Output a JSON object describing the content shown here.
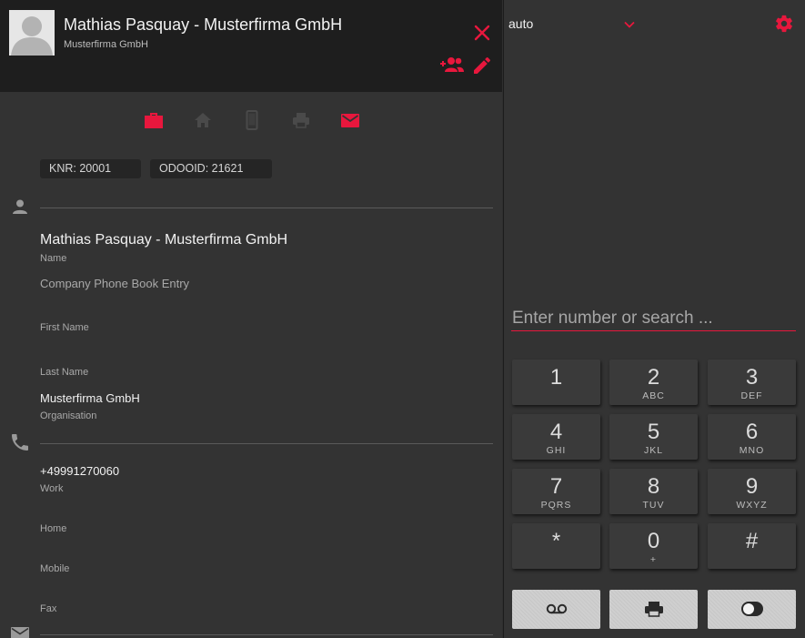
{
  "contact": {
    "title": "Mathias Pasquay - Musterfirma GmbH",
    "subtitle": "Musterfirma GmbH",
    "tags": [
      "KNR: 20001",
      "ODOOID: 21621"
    ]
  },
  "fields": {
    "name": {
      "value": "Mathias Pasquay - Musterfirma GmbH",
      "label": "Name"
    },
    "entry_type": "Company Phone Book Entry",
    "first_name": {
      "label": "First Name"
    },
    "last_name": {
      "label": "Last Name"
    },
    "organisation": {
      "value": "Musterfirma GmbH",
      "label": "Organisation"
    },
    "work": {
      "value": "+49991270060",
      "label": "Work"
    },
    "home": {
      "label": "Home"
    },
    "mobile": {
      "label": "Mobile"
    },
    "fax": {
      "label": "Fax"
    }
  },
  "dialer": {
    "mode": "auto",
    "search_placeholder": "Enter number or search ...",
    "keys": [
      {
        "digit": "1",
        "letters": ""
      },
      {
        "digit": "2",
        "letters": "ABC"
      },
      {
        "digit": "3",
        "letters": "DEF"
      },
      {
        "digit": "4",
        "letters": "GHI"
      },
      {
        "digit": "5",
        "letters": "JKL"
      },
      {
        "digit": "6",
        "letters": "MNO"
      },
      {
        "digit": "7",
        "letters": "PQRS"
      },
      {
        "digit": "8",
        "letters": "TUV"
      },
      {
        "digit": "9",
        "letters": "WXYZ"
      },
      {
        "digit": "*",
        "letters": ""
      },
      {
        "digit": "0",
        "letters": "+"
      },
      {
        "digit": "#",
        "letters": ""
      }
    ]
  },
  "icons": {
    "close": "close-icon",
    "add_contact": "group-add-icon",
    "edit": "pencil-icon",
    "work": "briefcase-icon",
    "home": "home-icon",
    "mobile": "smartphone-icon",
    "fax": "printer-icon",
    "email": "envelope-icon",
    "person": "person-icon",
    "phone": "phone-icon",
    "settings": "gear-icon",
    "voicemail": "voicemail-icon",
    "fax_action": "printer-icon",
    "toggle": "toggle-icon"
  },
  "colors": {
    "accent": "#e8173d",
    "header_bg": "#1e1e1e",
    "panel_bg": "#333333",
    "inactive_icon": "#4a4a4a",
    "button_bg": "#cfcfcf"
  }
}
